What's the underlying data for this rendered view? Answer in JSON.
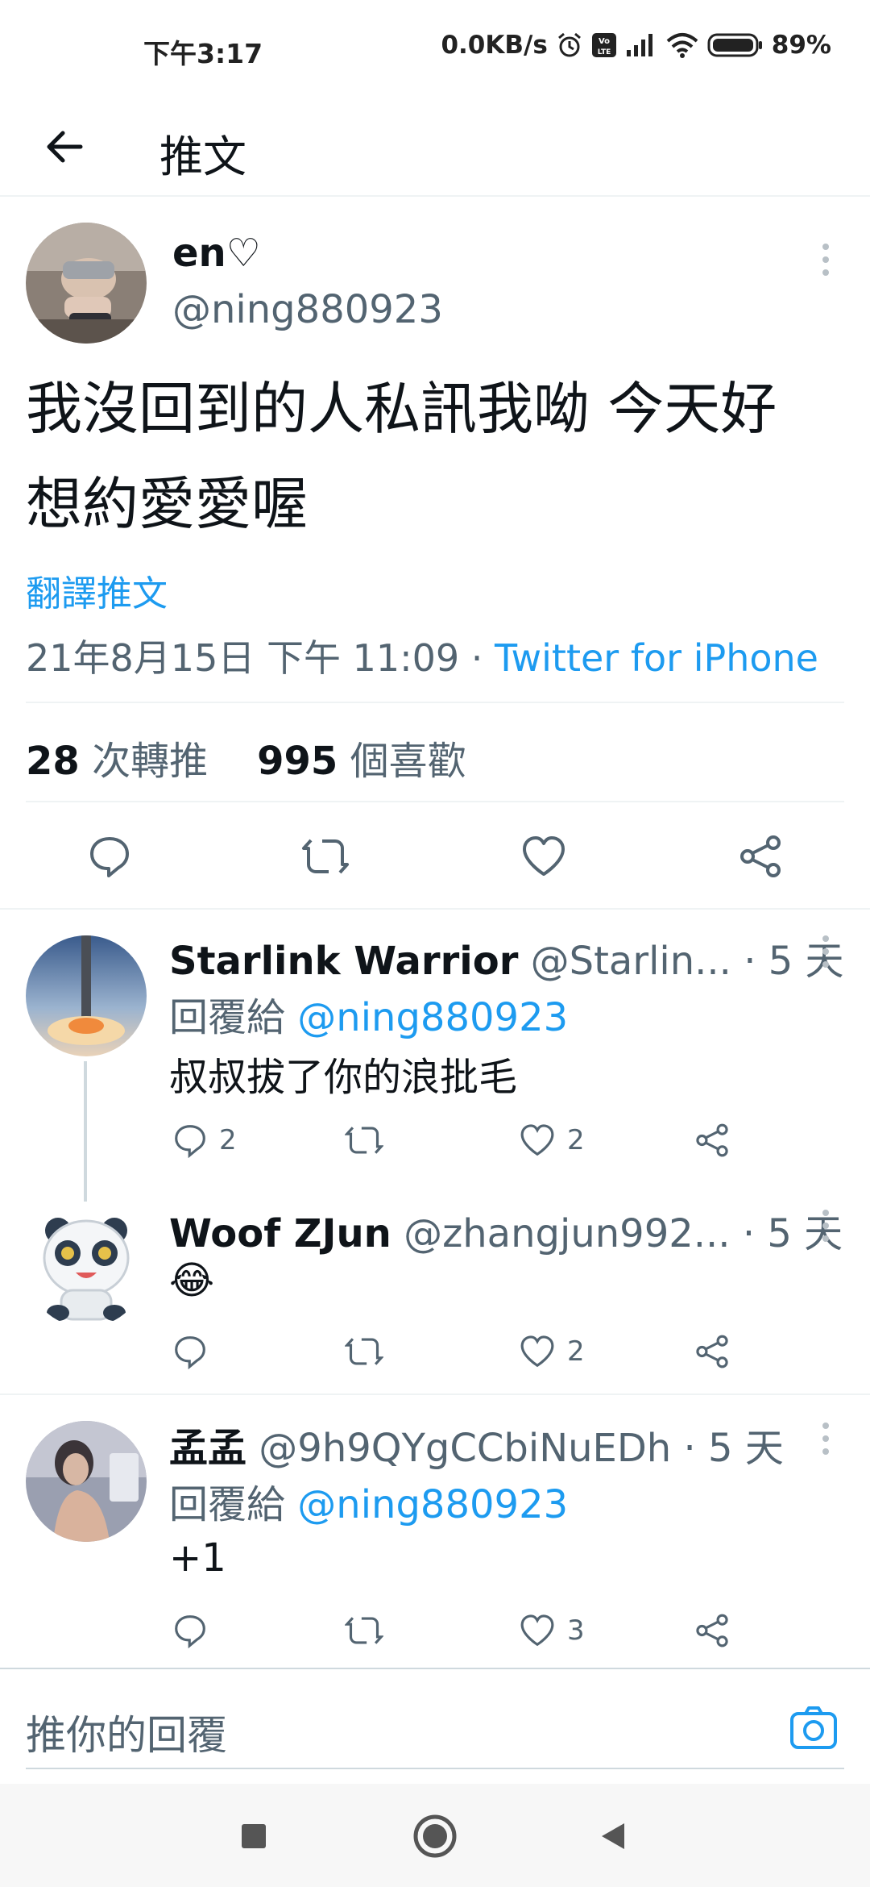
{
  "status_bar": {
    "time": "下午3:17",
    "network_speed": "0.0KB/s",
    "battery": "89%",
    "icons": [
      "alarm-icon",
      "volte-icon",
      "signal-icon",
      "wifi-icon",
      "battery-icon"
    ]
  },
  "header": {
    "back_icon": "arrow-left-icon",
    "title": "推文"
  },
  "main_tweet": {
    "name": "en♡",
    "handle": "@ning880923",
    "text_line1": "我沒回到的人私訊我呦 今天好",
    "text_line2": "想約愛愛喔",
    "translate_label": "翻譯推文",
    "timestamp": "21年8月15日 下午 11:09",
    "separator": " · ",
    "source": "Twitter for iPhone",
    "retweets_count": "28",
    "retweets_label": "次轉推",
    "likes_count": "995",
    "likes_label": "個喜歡"
  },
  "replies": [
    {
      "name": "Starlink Warrior",
      "handle": "@Starlin...",
      "time": "· 5 天",
      "reply_prefix": "回覆給",
      "reply_to": "@ning880923",
      "text": "叔叔拔了你的浪批毛",
      "reply_count": "2",
      "retweet_count": "",
      "like_count": "2"
    },
    {
      "name": "Woof ZJun",
      "handle": "@zhangjun992...",
      "time": "· 5 天",
      "text": "😂",
      "reply_count": "",
      "retweet_count": "",
      "like_count": "2"
    },
    {
      "name": "孟孟",
      "handle": "@9h9QYgCCbiNuEDh",
      "time": "· 5 天",
      "reply_prefix": "回覆給",
      "reply_to": "@ning880923",
      "text": "+1",
      "reply_count": "",
      "retweet_count": "",
      "like_count": "3"
    }
  ],
  "composer": {
    "placeholder": "推你的回覆",
    "camera_icon": "camera-icon"
  },
  "nav_bar": {
    "buttons": [
      "recents-square-icon",
      "home-circle-icon",
      "back-triangle-icon"
    ]
  },
  "colors": {
    "accent": "#1d9bf0",
    "text_primary": "#0f1419",
    "text_secondary": "#536471",
    "divider": "#eff3f4"
  }
}
